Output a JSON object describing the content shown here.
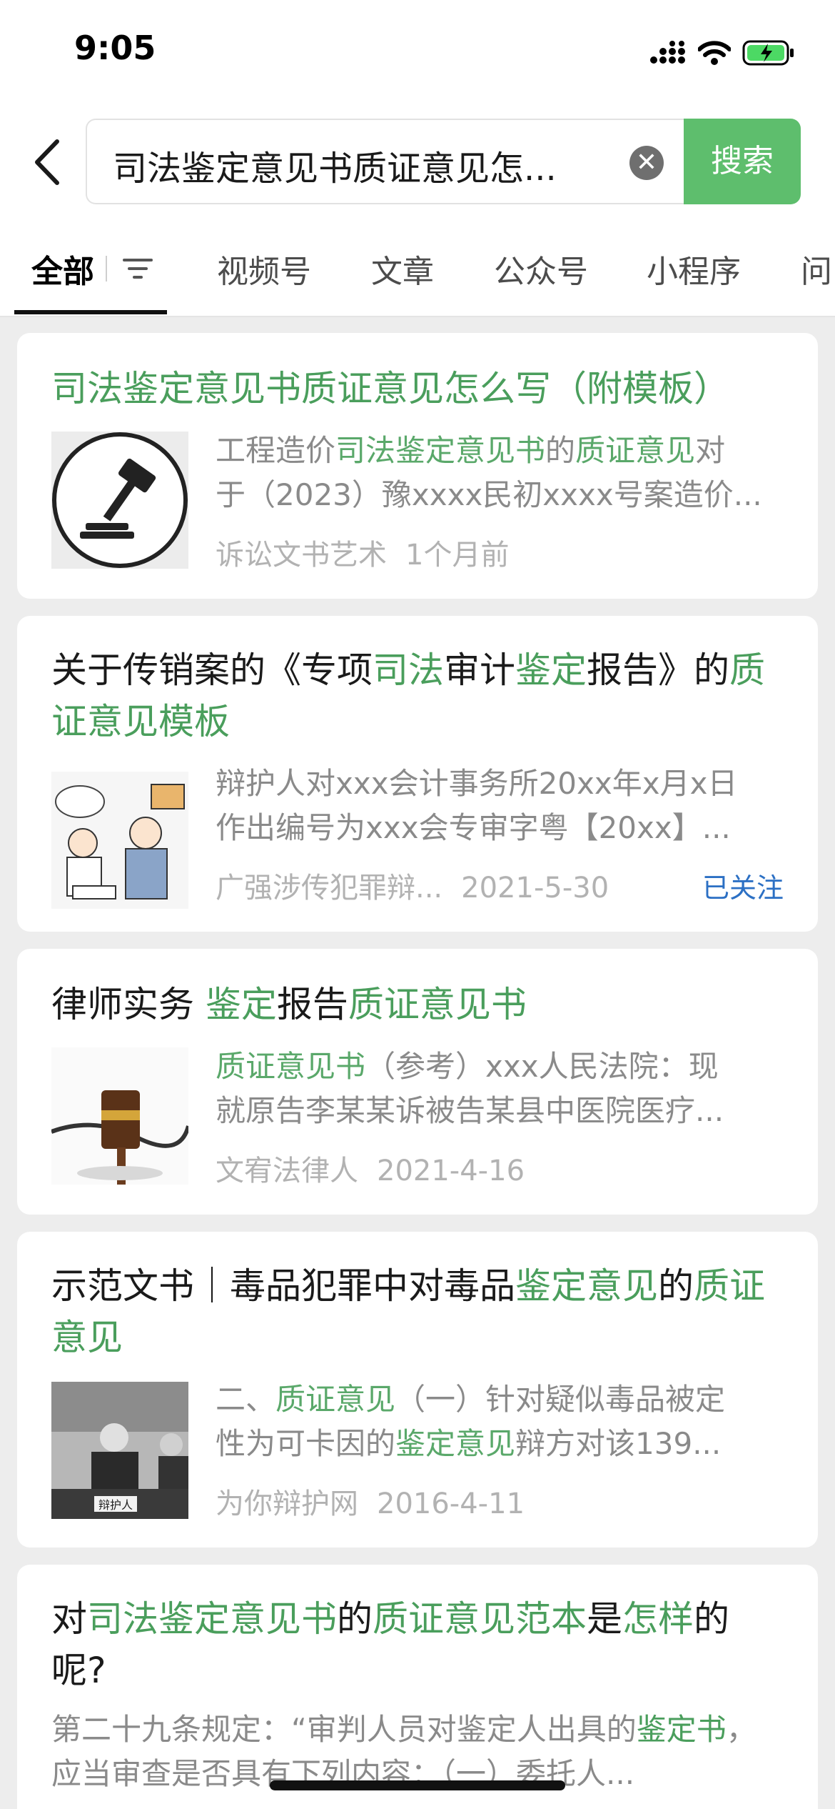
{
  "status": {
    "time": "9:05"
  },
  "search": {
    "query": "司法鉴定意见书质证意见怎...",
    "button_label": "搜索"
  },
  "tabs": [
    {
      "label": "全部"
    },
    {
      "label": "视频号"
    },
    {
      "label": "文章"
    },
    {
      "label": "公众号"
    },
    {
      "label": "小程序"
    },
    {
      "label": "问"
    }
  ],
  "results": [
    {
      "title_parts": [
        {
          "text": "司法鉴定意见书质证意见怎么写（附模板）",
          "hl": true
        }
      ],
      "snippet_lines": [
        [
          {
            "text": "工程造价",
            "hl": false
          },
          {
            "text": "司法鉴定意见书",
            "hl": true
          },
          {
            "text": "的",
            "hl": false
          },
          {
            "text": "质证意见",
            "hl": true
          },
          {
            "text": "对",
            "hl": false
          }
        ],
        [
          {
            "text": "于（2023）豫xxxx民初xxxx号案造价...",
            "hl": false
          }
        ]
      ],
      "source": "诉讼文书艺术",
      "date": "1个月前",
      "thumb_icon": "gavel-icon"
    },
    {
      "title_parts": [
        {
          "text": "关于传销案的《专项",
          "hl": false
        },
        {
          "text": "司法",
          "hl": true
        },
        {
          "text": "审计",
          "hl": false
        },
        {
          "text": "鉴定",
          "hl": true
        },
        {
          "text": "报告》的",
          "hl": false
        },
        {
          "text": "质证意见模板",
          "hl": true
        }
      ],
      "snippet_lines": [
        [
          {
            "text": "辩护人对xxx会计事务所20xx年x月x日",
            "hl": false
          }
        ],
        [
          {
            "text": "作出编号为xxx会专审字粤【20xx】...",
            "hl": false
          }
        ]
      ],
      "source": "广强涉传犯罪辩...",
      "date": "2021-5-30",
      "followed_label": "已关注",
      "thumb_icon": "cartoon-lawyer-image"
    },
    {
      "title_parts": [
        {
          "text": "律师实务 ",
          "hl": false
        },
        {
          "text": "鉴定",
          "hl": true
        },
        {
          "text": "报告",
          "hl": false
        },
        {
          "text": "质证意见书",
          "hl": true
        }
      ],
      "snippet_lines": [
        [
          {
            "text": "质证意见书",
            "hl": true
          },
          {
            "text": "（参考）xxx人民法院：现",
            "hl": false
          }
        ],
        [
          {
            "text": "就原告李某某诉被告某县中医院医疗...",
            "hl": false
          }
        ]
      ],
      "source": "文宥法律人",
      "date": "2021-4-16",
      "thumb_icon": "gavel-stethoscope-image"
    },
    {
      "title_parts": [
        {
          "text": "示范文书｜毒品犯罪中对毒品",
          "hl": false
        },
        {
          "text": "鉴定意见",
          "hl": true
        },
        {
          "text": "的",
          "hl": false
        },
        {
          "text": "质证意见",
          "hl": true
        }
      ],
      "snippet_lines": [
        [
          {
            "text": "二、",
            "hl": false
          },
          {
            "text": "质证意见",
            "hl": true
          },
          {
            "text": "（一）针对疑似毒品被定",
            "hl": false
          }
        ],
        [
          {
            "text": "性为可卡因的",
            "hl": false
          },
          {
            "text": "鉴定意见",
            "hl": true
          },
          {
            "text": "辩方对该139...",
            "hl": false
          }
        ]
      ],
      "source": "为你辩护网",
      "date": "2016-4-11",
      "thumb_icon": "courtroom-photo",
      "thumb_label": "辩护人"
    },
    {
      "title_parts": [
        {
          "text": "对",
          "hl": false
        },
        {
          "text": "司法鉴定意见书",
          "hl": true
        },
        {
          "text": "的",
          "hl": false
        },
        {
          "text": "质证意见范本",
          "hl": true
        },
        {
          "text": "是",
          "hl": false
        },
        {
          "text": "怎样",
          "hl": true
        },
        {
          "text": "的呢?",
          "hl": false
        }
      ],
      "snippet_parts": [
        {
          "text": "第二十九条规定：“审判人员对鉴定人出具的",
          "hl": false
        },
        {
          "text": "鉴定书",
          "hl": true
        },
        {
          "text": "，应当审查是否具有下列内容：（一）委托人...",
          "hl": false
        }
      ]
    }
  ],
  "colors": {
    "accent": "#5ebe6d",
    "highlight": "#4a9e5c",
    "link": "#2c70c4"
  }
}
